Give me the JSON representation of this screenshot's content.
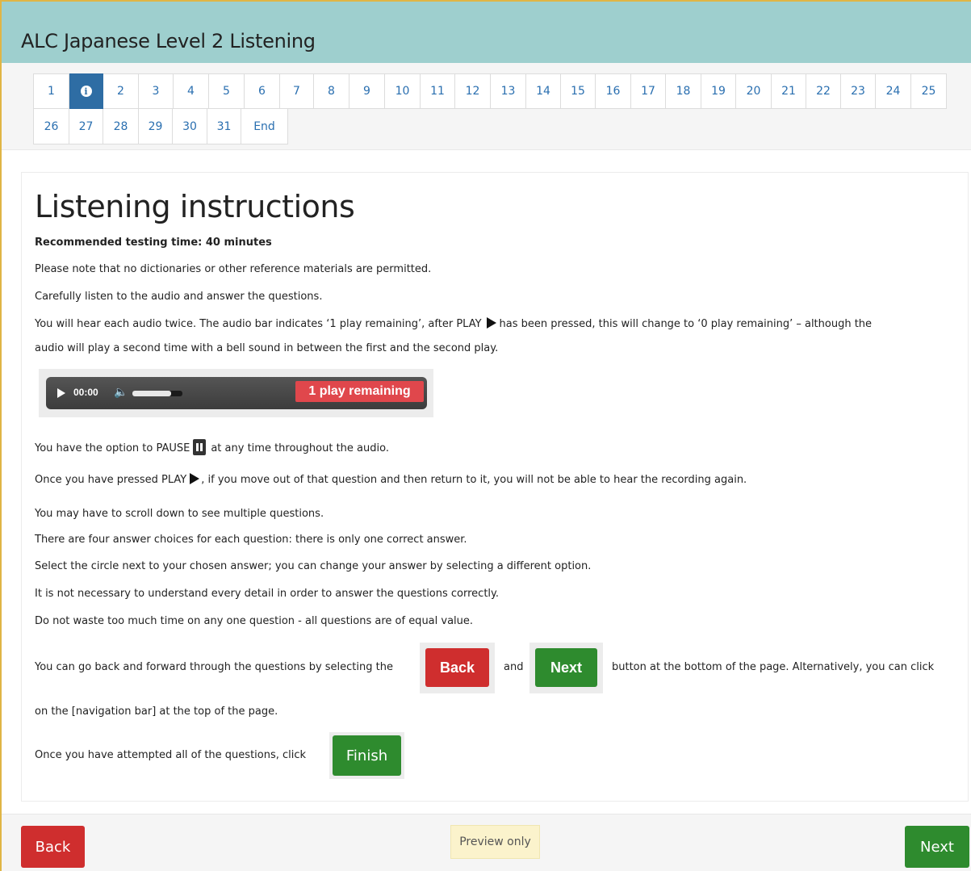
{
  "header": {
    "title": "ALC Japanese Level 2 Listening"
  },
  "nav": {
    "row1": [
      "1",
      "info",
      "2",
      "3",
      "4",
      "5",
      "6",
      "7",
      "8",
      "9",
      "10",
      "11",
      "12",
      "13",
      "14",
      "15",
      "16",
      "17",
      "18",
      "19",
      "20",
      "21",
      "22",
      "23",
      "24",
      "25"
    ],
    "row2": [
      "26",
      "27",
      "28",
      "29",
      "30",
      "31",
      "End"
    ],
    "active": "info"
  },
  "instructions": {
    "title": "Listening instructions",
    "recommended": "Recommended testing time: 40 minutes",
    "p1": "Please note that no dictionaries or other reference materials are permitted.",
    "p2": "Carefully listen to the audio and answer the questions.",
    "p3a": "You will hear each audio twice. The audio bar indicates ‘1 play remaining’, after PLAY",
    "p3b": "has been pressed, this will change to ‘0 play remaining’ – although the",
    "p3c": "audio will play a second time with a bell sound in between the first and the second play.",
    "p4a": "You have the option to PAUSE",
    "p4b": "at any time throughout the audio.",
    "p5a": "Once you have pressed PLAY",
    "p5b": ", if you move out of that question and then return to it, you will not be able to hear the recording again.",
    "p6": "You may have to scroll down to see multiple questions.",
    "p7": "There are four answer choices for each question:  there is only one correct answer.",
    "p8": "Select the circle next to your chosen answer; you can change your answer by selecting a different option.",
    "p9": "It is not necessary to understand every detail in order to answer the questions correctly.",
    "p10": "Do not waste too much time on any one question - all questions are of equal value.",
    "p11a": "You can go back and forward through the questions by selecting the",
    "p11and": "and",
    "p11b": "button at the bottom of the page. Alternatively, you can click",
    "p11c": "on the [navigation bar] at the top of the page.",
    "p12": "Once you have attempted all of the questions, click",
    "sample_back": "Back",
    "sample_next": "Next",
    "sample_finish": "Finish"
  },
  "audio": {
    "time": "00:00",
    "remaining": "1 play remaining",
    "volume_level": 0.78
  },
  "footer": {
    "back": "Back",
    "preview": "Preview only",
    "next": "Next"
  },
  "colors": {
    "header_bg": "#9ecfce",
    "nav_active": "#2e6da4",
    "back_red": "#cf2e2e",
    "next_green": "#2e8b2e",
    "remaining_red": "#e0474c"
  }
}
